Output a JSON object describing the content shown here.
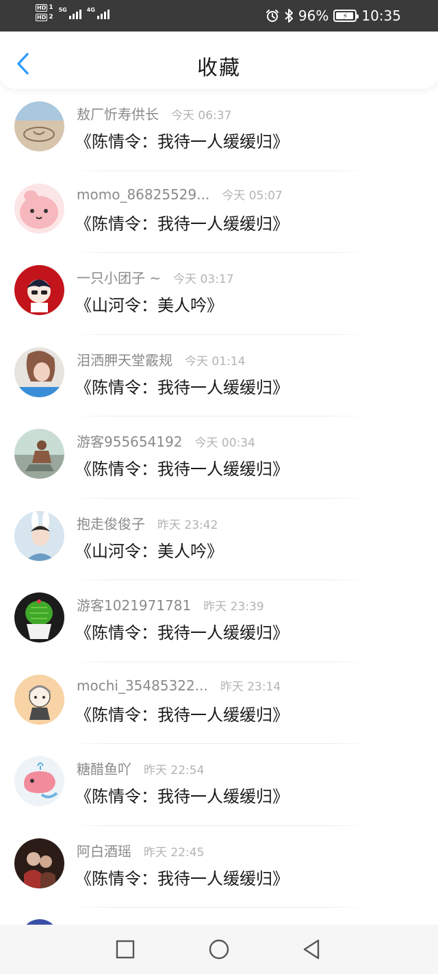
{
  "status_bar": {
    "sim1": "HD",
    "sim1_slot": "1",
    "sim2": "HD",
    "sim2_slot": "2",
    "net1": "5G",
    "net2": "4G",
    "battery": "96%",
    "time": "10:35",
    "icons": [
      "alarm-icon",
      "bluetooth-icon",
      "battery-charging-icon"
    ]
  },
  "header": {
    "title": "收藏",
    "back_icon": "chevron-left-icon",
    "accent": "#2f9bff"
  },
  "items": [
    {
      "user": "敖厂忻寿供长",
      "time": "今天 06:37",
      "song": "《陈情令：我待一人缓缓归》",
      "avatar": "beach"
    },
    {
      "user": "momo_86825529...",
      "time": "今天 05:07",
      "song": "《陈情令：我待一人缓缓归》",
      "avatar": "pink-blob"
    },
    {
      "user": "一只小团子 ~",
      "time": "今天 03:17",
      "song": "《山河令：美人吟》",
      "avatar": "anime-boy-red"
    },
    {
      "user": "泪洒胛天堂霰规",
      "time": "今天 01:14",
      "song": "《陈情令：我待一人缓缓归》",
      "avatar": "girl-photo"
    },
    {
      "user": "游客955654192",
      "time": "今天 00:34",
      "song": "《陈情令：我待一人缓缓归》",
      "avatar": "man-sitting"
    },
    {
      "user": "抱走俊俊子",
      "time": "昨天 23:42",
      "song": "《山河令：美人吟》",
      "avatar": "boy-bunny-ears"
    },
    {
      "user": "游客1021971781",
      "time": "昨天 23:39",
      "song": "《陈情令：我待一人缓缓归》",
      "avatar": "cactus"
    },
    {
      "user": "mochi_35485322...",
      "time": "昨天 23:14",
      "song": "《陈情令：我待一人缓缓归》",
      "avatar": "chibi-sketch"
    },
    {
      "user": "糖醋鱼吖",
      "time": "昨天 22:54",
      "song": "《陈情令：我待一人缓缓归》",
      "avatar": "pink-whale"
    },
    {
      "user": "阿白酒瑶",
      "time": "昨天 22:45",
      "song": "《陈情令：我待一人缓缓归》",
      "avatar": "dark-illustration"
    }
  ],
  "nav_bar": {
    "buttons": [
      "recent-apps-icon",
      "home-icon",
      "back-icon"
    ]
  }
}
